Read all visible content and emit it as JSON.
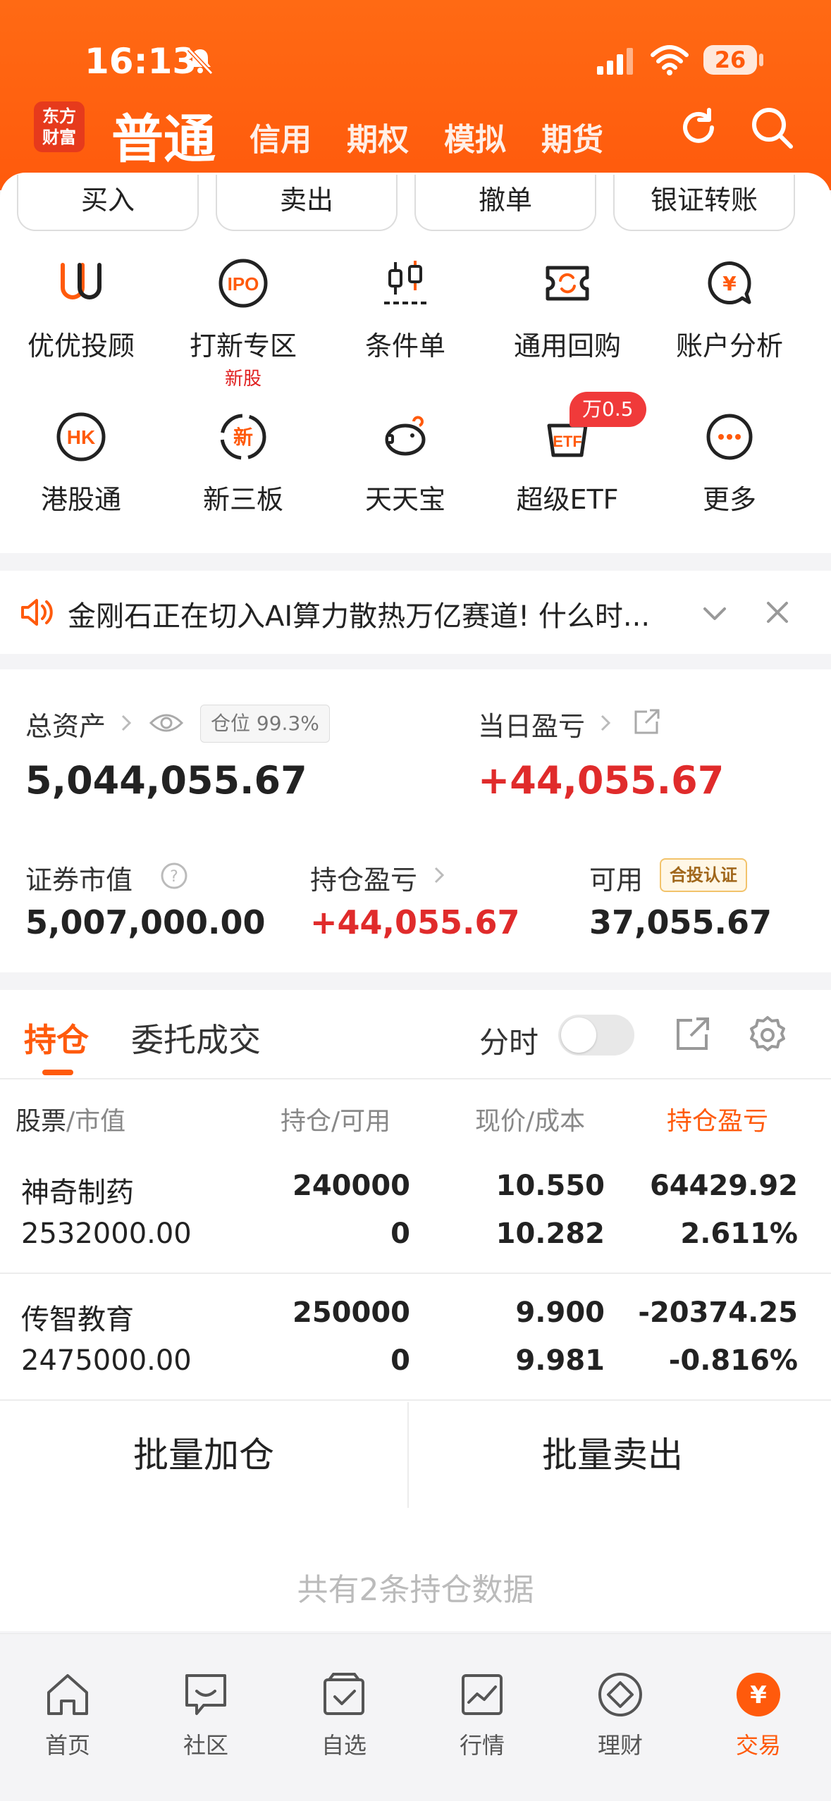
{
  "status_bar": {
    "time": "16:13",
    "battery": "26"
  },
  "header": {
    "logo_line1": "东方",
    "logo_line2": "财富",
    "active_tab": "普通",
    "tabs": [
      "信用",
      "期权",
      "模拟",
      "期货"
    ]
  },
  "actions": [
    "买入",
    "卖出",
    "撤单",
    "银证转账"
  ],
  "grid": [
    {
      "label": "优优投顾",
      "icon": "uu-advisor-icon"
    },
    {
      "label": "打新专区",
      "sub": "新股",
      "icon": "ipo-icon"
    },
    {
      "label": "条件单",
      "icon": "conditional-order-icon"
    },
    {
      "label": "通用回购",
      "icon": "repo-icon"
    },
    {
      "label": "账户分析",
      "icon": "account-analysis-icon"
    },
    {
      "label": "港股通",
      "icon": "hk-icon"
    },
    {
      "label": "新三板",
      "icon": "new-third-board-icon"
    },
    {
      "label": "天天宝",
      "icon": "piggy-bank-icon"
    },
    {
      "label": "超级ETF",
      "icon": "etf-icon",
      "badge": "万0.5"
    },
    {
      "label": "更多",
      "icon": "more-icon"
    }
  ],
  "news": {
    "text": "金刚石正在切入AI算力散热万亿赛道! 什么时..."
  },
  "assets": {
    "total_label": "总资产",
    "position_label": "仓位",
    "position_value": "99.3%",
    "total_value": "5,044,055.67",
    "daily_pnl_label": "当日盈亏",
    "daily_pnl_value": "+44,055.67",
    "market_value_label": "证券市值",
    "market_value": "5,007,000.00",
    "holding_pnl_label": "持仓盈亏",
    "holding_pnl_value": "+44,055.67",
    "available_label": "可用",
    "cert_badge": "合投认证",
    "available_value": "37,055.67"
  },
  "holdings": {
    "tabs": [
      "持仓",
      "委托成交"
    ],
    "timeshare_label": "分时",
    "headers": {
      "stock": "股票",
      "market": "市值",
      "position": "持仓",
      "available": "可用",
      "price": "现价",
      "cost": "成本",
      "pnl": "持仓盈亏"
    },
    "rows": [
      {
        "name": "神奇制药",
        "market_value": "2532000.00",
        "position": "240000",
        "available": "0",
        "price": "10.550",
        "cost": "10.282",
        "pnl": "64429.92",
        "pnl_pct": "2.611%",
        "direction": "up"
      },
      {
        "name": "传智教育",
        "market_value": "2475000.00",
        "position": "250000",
        "available": "0",
        "price": "9.900",
        "cost": "9.981",
        "pnl": "-20374.25",
        "pnl_pct": "-0.816%",
        "direction": "down"
      }
    ],
    "bulk_add": "批量加仓",
    "bulk_sell": "批量卖出",
    "footer": "共有2条持仓数据"
  },
  "bottom_nav": [
    {
      "label": "首页",
      "icon": "home-icon"
    },
    {
      "label": "社区",
      "icon": "community-icon"
    },
    {
      "label": "自选",
      "icon": "watchlist-icon"
    },
    {
      "label": "行情",
      "icon": "market-icon"
    },
    {
      "label": "理财",
      "icon": "wealth-icon"
    },
    {
      "label": "交易",
      "icon": "trade-icon",
      "active": true
    }
  ],
  "colors": {
    "brand": "#ff5a0c",
    "up": "#e02b2b",
    "down": "#1ba11b"
  }
}
